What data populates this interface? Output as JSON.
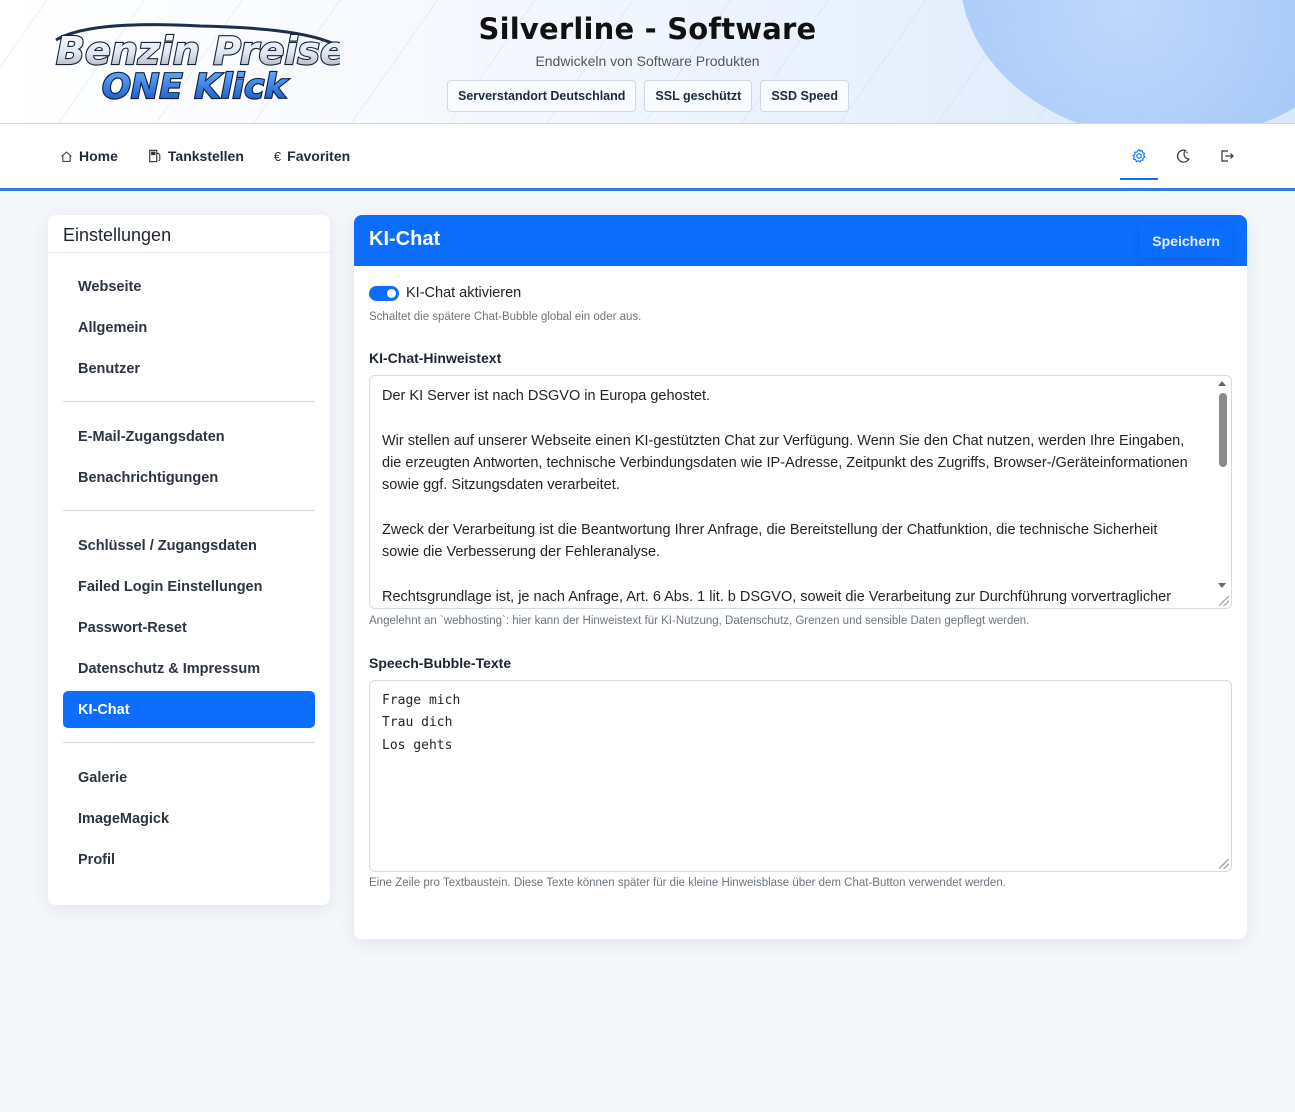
{
  "header": {
    "logo_line1": "Benzin Preise",
    "logo_line2": "ONE Klick",
    "title": "Silverline - Software",
    "subtitle": "Endwickeln von Software Produkten",
    "badges": [
      "Serverstandort Deutschland",
      "SSL geschützt",
      "SSD Speed"
    ]
  },
  "nav": {
    "items": [
      {
        "icon": "home-icon",
        "label": "Home"
      },
      {
        "icon": "gas-pump-icon",
        "label": "Tankstellen"
      },
      {
        "icon": "euro-icon",
        "glyph": "€",
        "label": "Favoriten"
      }
    ],
    "right_icons": [
      "gear-icon",
      "moon-icon",
      "logout-icon"
    ]
  },
  "sidebar": {
    "title": "Einstellungen",
    "groups": [
      [
        "Webseite",
        "Allgemein",
        "Benutzer"
      ],
      [
        "E-Mail-Zugangsdaten",
        "Benachrichtigungen"
      ],
      [
        "Schlüssel / Zugangsdaten",
        "Failed Login Einstellungen",
        "Passwort-Reset",
        "Datenschutz & Impressum",
        "KI-Chat"
      ],
      [
        "Galerie",
        "ImageMagick",
        "Profil"
      ]
    ],
    "active": "KI-Chat"
  },
  "card": {
    "title": "KI-Chat",
    "save_label": "Speichern",
    "toggle": {
      "label": "KI-Chat aktivieren",
      "checked": true,
      "help": "Schaltet die spätere Chat-Bubble global ein oder aus."
    },
    "hint": {
      "label": "KI-Chat-Hinweistext",
      "value": "Der KI Server ist nach DSGVO in Europa gehostet.\n\nWir stellen auf unserer Webseite einen KI-gestützten Chat zur Verfügung. Wenn Sie den Chat nutzen, werden Ihre Eingaben, die erzeugten Antworten, technische Verbindungsdaten wie IP-Adresse, Zeitpunkt des Zugriffs, Browser-/Geräteinformationen sowie ggf. Sitzungsdaten verarbeitet.\n\nZweck der Verarbeitung ist die Beantwortung Ihrer Anfrage, die Bereitstellung der Chatfunktion, die technische Sicherheit sowie die Verbesserung der Fehleranalyse.\n\nRechtsgrundlage ist, je nach Anfrage, Art. 6 Abs. 1 lit. b DSGVO, soweit die Verarbeitung zur Durchführung vorvertraglicher",
      "help": "Angelehnt an `webhosting`: hier kann der Hinweistext für KI-Nutzung, Datenschutz, Grenzen und sensible Daten gepflegt werden."
    },
    "bubbles": {
      "label": "Speech-Bubble-Texte",
      "value": "Frage mich\nTrau dich\nLos gehts",
      "help": "Eine Zeile pro Textbaustein. Diese Texte können später für die kleine Hinweisblase über dem Chat-Button verwendet werden."
    }
  },
  "colors": {
    "accent": "#0d6efd",
    "nav_border": "#2f7be6",
    "logo_blue": "#1565d8"
  }
}
